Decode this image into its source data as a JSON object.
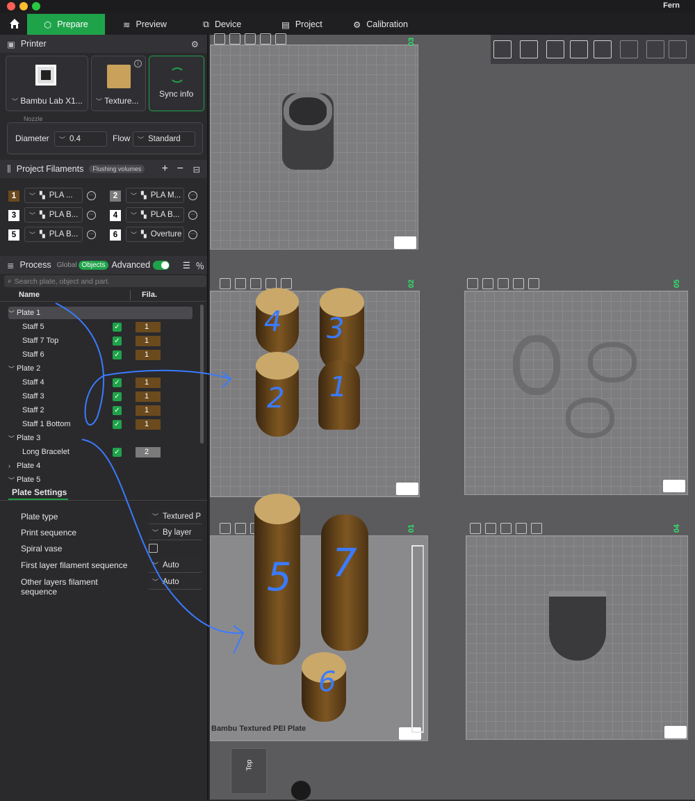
{
  "app": {
    "name": "Fern"
  },
  "nav": {
    "home_icon": "home-icon",
    "tabs": [
      {
        "label": "Prepare",
        "icon": "cube-icon",
        "active": true
      },
      {
        "label": "Preview",
        "icon": "layers-icon"
      },
      {
        "label": "Device",
        "icon": "device-icon"
      },
      {
        "label": "Project",
        "icon": "project-icon"
      },
      {
        "label": "Calibration",
        "icon": "calibration-icon"
      }
    ]
  },
  "printer": {
    "section_title": "Printer",
    "printer_name": "Bambu Lab X1...",
    "plate_name": "Texture...",
    "sync_label": "Sync info",
    "nozzle_label": "Nozzle",
    "diameter_label": "Diameter",
    "diameter_value": "0.4",
    "flow_label": "Flow",
    "flow_value": "Standard"
  },
  "filaments": {
    "section_title": "Project Filaments",
    "flushing_label": "Flushing volumes",
    "items": [
      {
        "num": "1",
        "label": "PLA ...",
        "color": "#6b4a1d"
      },
      {
        "num": "2",
        "label": "PLA M...",
        "color": "#7a7a7a"
      },
      {
        "num": "3",
        "label": "PLA B...",
        "color": "#ffffff"
      },
      {
        "num": "4",
        "label": "PLA B...",
        "color": "#ffffff"
      },
      {
        "num": "5",
        "label": "PLA B...",
        "color": "#ffffff"
      },
      {
        "num": "6",
        "label": "Overture ...",
        "color": "#ffffff"
      }
    ]
  },
  "process": {
    "section_title": "Process",
    "global_label": "Global",
    "objects_label": "Objects",
    "advanced_label": "Advanced",
    "search_placeholder": "Search plate, object and part.",
    "col_name": "Name",
    "col_fila": "Fila.",
    "tree": [
      {
        "type": "plate",
        "label": "Plate 1",
        "expanded": true
      },
      {
        "type": "obj",
        "label": "Staff 5",
        "fila": "1"
      },
      {
        "type": "obj",
        "label": "Staff 7 Top",
        "fila": "1"
      },
      {
        "type": "obj",
        "label": "Staff 6",
        "fila": "1"
      },
      {
        "type": "plate",
        "label": "Plate 2",
        "expanded": true
      },
      {
        "type": "obj",
        "label": "Staff 4",
        "fila": "1"
      },
      {
        "type": "obj",
        "label": "Staff 3",
        "fila": "1"
      },
      {
        "type": "obj",
        "label": "Staff 2",
        "fila": "1"
      },
      {
        "type": "obj",
        "label": "Staff 1 Bottom",
        "fila": "1"
      },
      {
        "type": "plate",
        "label": "Plate 3",
        "expanded": true
      },
      {
        "type": "obj",
        "label": "Long Bracelet",
        "fila": "2"
      },
      {
        "type": "plate",
        "label": "Plate 4",
        "expanded": false
      },
      {
        "type": "plate",
        "label": "Plate 5",
        "expanded": true
      }
    ]
  },
  "plate_settings": {
    "title": "Plate Settings",
    "rows": [
      {
        "label": "Plate type",
        "value": "Textured P"
      },
      {
        "label": "Print sequence",
        "value": "By layer"
      },
      {
        "label": "Spiral vase",
        "value": ""
      },
      {
        "label": "First layer filament sequence",
        "value": "Auto"
      },
      {
        "label": "Other layers filament sequence",
        "value": "Auto"
      }
    ]
  },
  "viewport": {
    "plate_numbers": [
      "03",
      "02",
      "05",
      "01",
      "04"
    ],
    "plate_label": "Bambu Textured PEI Plate",
    "view_cube_label": "Top",
    "handwritten": [
      "4",
      "3",
      "2",
      "1",
      "5",
      "7",
      "6"
    ]
  }
}
